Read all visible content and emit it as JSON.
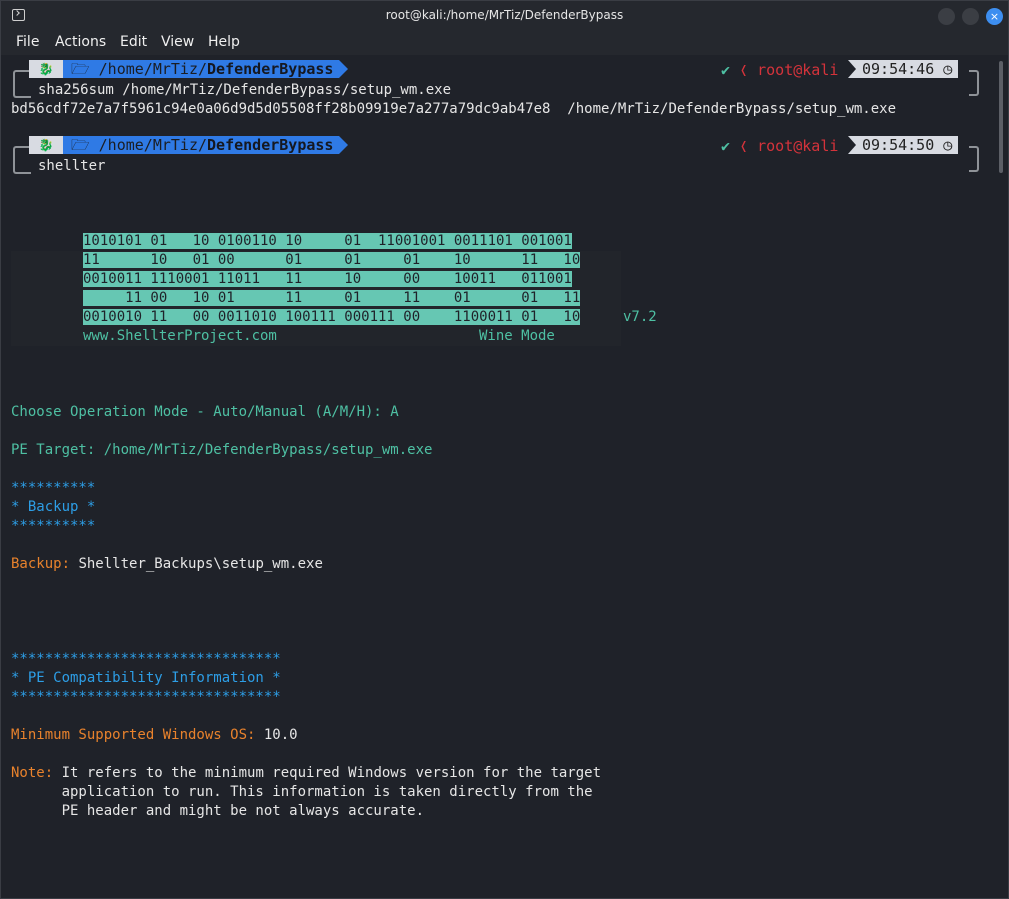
{
  "window": {
    "title": "root@kali:/home/MrTiz/DefenderBypass",
    "close_glyph": "×"
  },
  "menu": [
    "File",
    "Actions",
    "Edit",
    "View",
    "Help"
  ],
  "prompt1": {
    "path_prefix": "/home/",
    "path_user": "MrTiz",
    "path_sep": "/",
    "path_dir": "DefenderBypass",
    "check": "✔",
    "user": "root@kali",
    "time": "09:54:46",
    "command": "sha256sum /home/MrTiz/DefenderBypass/setup_wm.exe"
  },
  "output1": "bd56cdf72e7a7f5961c94e0a06d9d5d05508ff28b09919e7a277a79dc9ab47e8  /home/MrTiz/DefenderBypass/setup_wm.exe",
  "prompt2": {
    "path_prefix": "/home/",
    "path_user": "MrTiz",
    "path_sep": "/",
    "path_dir": "DefenderBypass",
    "check": "✔",
    "user": "root@kali",
    "time": "09:54:50",
    "command": "shellter"
  },
  "banner": {
    "rows": [
      "1010101 01   10 0100110 10     01  11001001 0011101 001001",
      "11      10   01 00      01     01     01    10      11   10",
      "0010011 1110001 11011   11     10     00    10011   011001",
      "     11 00   10 01      11     01     11    01      01   11",
      "0010010 11   00 0011010 100111 000111 00    1100011 01   10"
    ],
    "version": "v7.2",
    "url": "www.ShellterProject.com",
    "mode": "Wine Mode"
  },
  "lines": {
    "op_mode": "Choose Operation Mode - Auto/Manual (A/M/H): A",
    "pe_target": "PE Target: /home/MrTiz/DefenderBypass/setup_wm.exe",
    "backup_stars": "**********",
    "backup_title": "* Backup *",
    "backup_label": "Backup:",
    "backup_value": " Shellter_Backups\\setup_wm.exe",
    "pe_stars": "********************************",
    "pe_title": "* PE Compatibility Information *",
    "min_os_label": "Minimum Supported Windows OS:",
    "min_os_value": " 10.0",
    "note_label": "Note:",
    "note_1": " It refers to the minimum required Windows version for the target",
    "note_2": "      application to run. This information is taken directly from the",
    "note_3": "      PE header and might be not always accurate."
  }
}
